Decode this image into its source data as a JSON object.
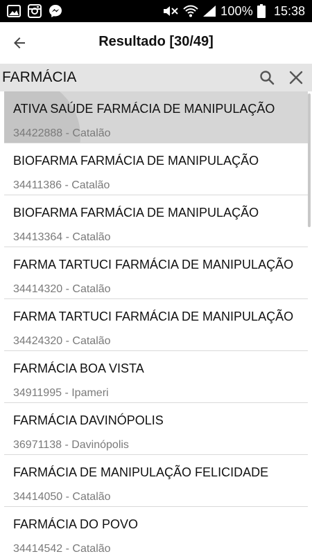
{
  "status_bar": {
    "icons_left": [
      "image-icon",
      "instagram-icon",
      "messenger-icon"
    ],
    "icons_right": [
      "mute-icon",
      "wifi-icon",
      "signal-icon",
      "battery-icon"
    ],
    "battery_percent": "100%",
    "time": "15:38"
  },
  "app_bar": {
    "title": "Resultado  [30/49]"
  },
  "search": {
    "value": "FARMÁCIA"
  },
  "results": [
    {
      "name": "ATIVA SAÚDE FARMÁCIA DE MANIPULAÇÃO",
      "phone": "34422888",
      "city": "Catalão",
      "subtitle": "34422888 - Catalão"
    },
    {
      "name": "BIOFARMA FARMÁCIA DE MANIPULAÇÃO",
      "phone": "34411386",
      "city": "Catalão",
      "subtitle": "34411386 - Catalão"
    },
    {
      "name": "BIOFARMA FARMÁCIA DE MANIPULAÇÃO",
      "phone": "34413364",
      "city": "Catalão",
      "subtitle": "34413364 - Catalão"
    },
    {
      "name": "FARMA TARTUCI FARMÁCIA DE MANIPULAÇÃO",
      "phone": "34414320",
      "city": "Catalão",
      "subtitle": "34414320 - Catalão"
    },
    {
      "name": "FARMA TARTUCI FARMÁCIA DE MANIPULAÇÃO",
      "phone": "34424320",
      "city": "Catalão",
      "subtitle": "34424320 - Catalão"
    },
    {
      "name": "FARMÁCIA BOA VISTA",
      "phone": "34911995",
      "city": "Ipameri",
      "subtitle": "34911995 - Ipameri"
    },
    {
      "name": "FARMÁCIA DAVINÓPOLIS",
      "phone": "36971138",
      "city": "Davinópolis",
      "subtitle": "36971138 - Davinópolis"
    },
    {
      "name": "FARMÁCIA DE MANIPULAÇÃO FELICIDADE",
      "phone": "34414050",
      "city": "Catalão",
      "subtitle": "34414050 - Catalão"
    },
    {
      "name": "FARMÁCIA DO POVO",
      "phone": "34414542",
      "city": "Catalão",
      "subtitle": "34414542 - Catalão"
    }
  ],
  "colors": {
    "status_bar_bg": "#000000",
    "search_bar_bg": "#e4e4e4",
    "pressed_item_bg": "#d6d6d6",
    "divider": "#d9d9d9",
    "subtitle_text": "#7a7a7a"
  }
}
